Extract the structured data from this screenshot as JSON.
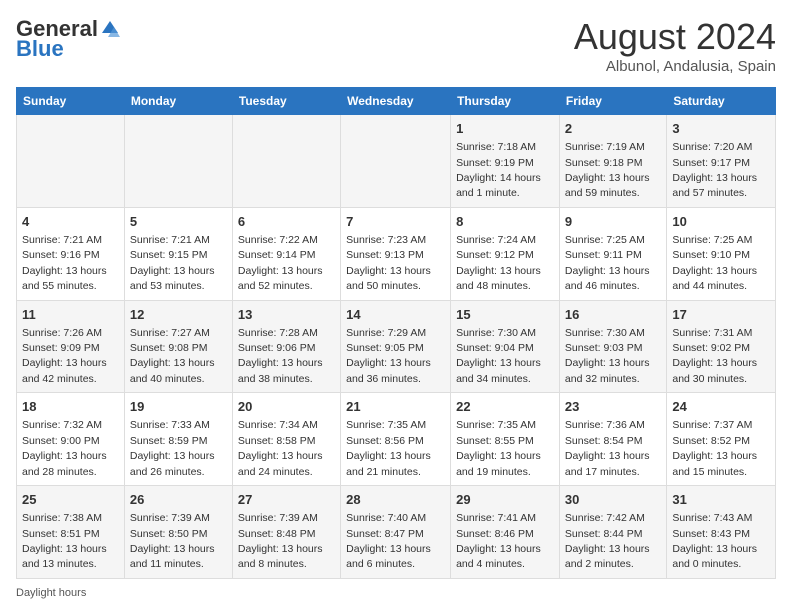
{
  "header": {
    "logo_general": "General",
    "logo_blue": "Blue",
    "month_title": "August 2024",
    "subtitle": "Albunol, Andalusia, Spain"
  },
  "days_of_week": [
    "Sunday",
    "Monday",
    "Tuesday",
    "Wednesday",
    "Thursday",
    "Friday",
    "Saturday"
  ],
  "weeks": [
    [
      {
        "day": "",
        "info": ""
      },
      {
        "day": "",
        "info": ""
      },
      {
        "day": "",
        "info": ""
      },
      {
        "day": "",
        "info": ""
      },
      {
        "day": "1",
        "info": "Sunrise: 7:18 AM\nSunset: 9:19 PM\nDaylight: 14 hours and 1 minute."
      },
      {
        "day": "2",
        "info": "Sunrise: 7:19 AM\nSunset: 9:18 PM\nDaylight: 13 hours and 59 minutes."
      },
      {
        "day": "3",
        "info": "Sunrise: 7:20 AM\nSunset: 9:17 PM\nDaylight: 13 hours and 57 minutes."
      }
    ],
    [
      {
        "day": "4",
        "info": "Sunrise: 7:21 AM\nSunset: 9:16 PM\nDaylight: 13 hours and 55 minutes."
      },
      {
        "day": "5",
        "info": "Sunrise: 7:21 AM\nSunset: 9:15 PM\nDaylight: 13 hours and 53 minutes."
      },
      {
        "day": "6",
        "info": "Sunrise: 7:22 AM\nSunset: 9:14 PM\nDaylight: 13 hours and 52 minutes."
      },
      {
        "day": "7",
        "info": "Sunrise: 7:23 AM\nSunset: 9:13 PM\nDaylight: 13 hours and 50 minutes."
      },
      {
        "day": "8",
        "info": "Sunrise: 7:24 AM\nSunset: 9:12 PM\nDaylight: 13 hours and 48 minutes."
      },
      {
        "day": "9",
        "info": "Sunrise: 7:25 AM\nSunset: 9:11 PM\nDaylight: 13 hours and 46 minutes."
      },
      {
        "day": "10",
        "info": "Sunrise: 7:25 AM\nSunset: 9:10 PM\nDaylight: 13 hours and 44 minutes."
      }
    ],
    [
      {
        "day": "11",
        "info": "Sunrise: 7:26 AM\nSunset: 9:09 PM\nDaylight: 13 hours and 42 minutes."
      },
      {
        "day": "12",
        "info": "Sunrise: 7:27 AM\nSunset: 9:08 PM\nDaylight: 13 hours and 40 minutes."
      },
      {
        "day": "13",
        "info": "Sunrise: 7:28 AM\nSunset: 9:06 PM\nDaylight: 13 hours and 38 minutes."
      },
      {
        "day": "14",
        "info": "Sunrise: 7:29 AM\nSunset: 9:05 PM\nDaylight: 13 hours and 36 minutes."
      },
      {
        "day": "15",
        "info": "Sunrise: 7:30 AM\nSunset: 9:04 PM\nDaylight: 13 hours and 34 minutes."
      },
      {
        "day": "16",
        "info": "Sunrise: 7:30 AM\nSunset: 9:03 PM\nDaylight: 13 hours and 32 minutes."
      },
      {
        "day": "17",
        "info": "Sunrise: 7:31 AM\nSunset: 9:02 PM\nDaylight: 13 hours and 30 minutes."
      }
    ],
    [
      {
        "day": "18",
        "info": "Sunrise: 7:32 AM\nSunset: 9:00 PM\nDaylight: 13 hours and 28 minutes."
      },
      {
        "day": "19",
        "info": "Sunrise: 7:33 AM\nSunset: 8:59 PM\nDaylight: 13 hours and 26 minutes."
      },
      {
        "day": "20",
        "info": "Sunrise: 7:34 AM\nSunset: 8:58 PM\nDaylight: 13 hours and 24 minutes."
      },
      {
        "day": "21",
        "info": "Sunrise: 7:35 AM\nSunset: 8:56 PM\nDaylight: 13 hours and 21 minutes."
      },
      {
        "day": "22",
        "info": "Sunrise: 7:35 AM\nSunset: 8:55 PM\nDaylight: 13 hours and 19 minutes."
      },
      {
        "day": "23",
        "info": "Sunrise: 7:36 AM\nSunset: 8:54 PM\nDaylight: 13 hours and 17 minutes."
      },
      {
        "day": "24",
        "info": "Sunrise: 7:37 AM\nSunset: 8:52 PM\nDaylight: 13 hours and 15 minutes."
      }
    ],
    [
      {
        "day": "25",
        "info": "Sunrise: 7:38 AM\nSunset: 8:51 PM\nDaylight: 13 hours and 13 minutes."
      },
      {
        "day": "26",
        "info": "Sunrise: 7:39 AM\nSunset: 8:50 PM\nDaylight: 13 hours and 11 minutes."
      },
      {
        "day": "27",
        "info": "Sunrise: 7:39 AM\nSunset: 8:48 PM\nDaylight: 13 hours and 8 minutes."
      },
      {
        "day": "28",
        "info": "Sunrise: 7:40 AM\nSunset: 8:47 PM\nDaylight: 13 hours and 6 minutes."
      },
      {
        "day": "29",
        "info": "Sunrise: 7:41 AM\nSunset: 8:46 PM\nDaylight: 13 hours and 4 minutes."
      },
      {
        "day": "30",
        "info": "Sunrise: 7:42 AM\nSunset: 8:44 PM\nDaylight: 13 hours and 2 minutes."
      },
      {
        "day": "31",
        "info": "Sunrise: 7:43 AM\nSunset: 8:43 PM\nDaylight: 13 hours and 0 minutes."
      }
    ]
  ],
  "footer": {
    "daylight_label": "Daylight hours"
  }
}
